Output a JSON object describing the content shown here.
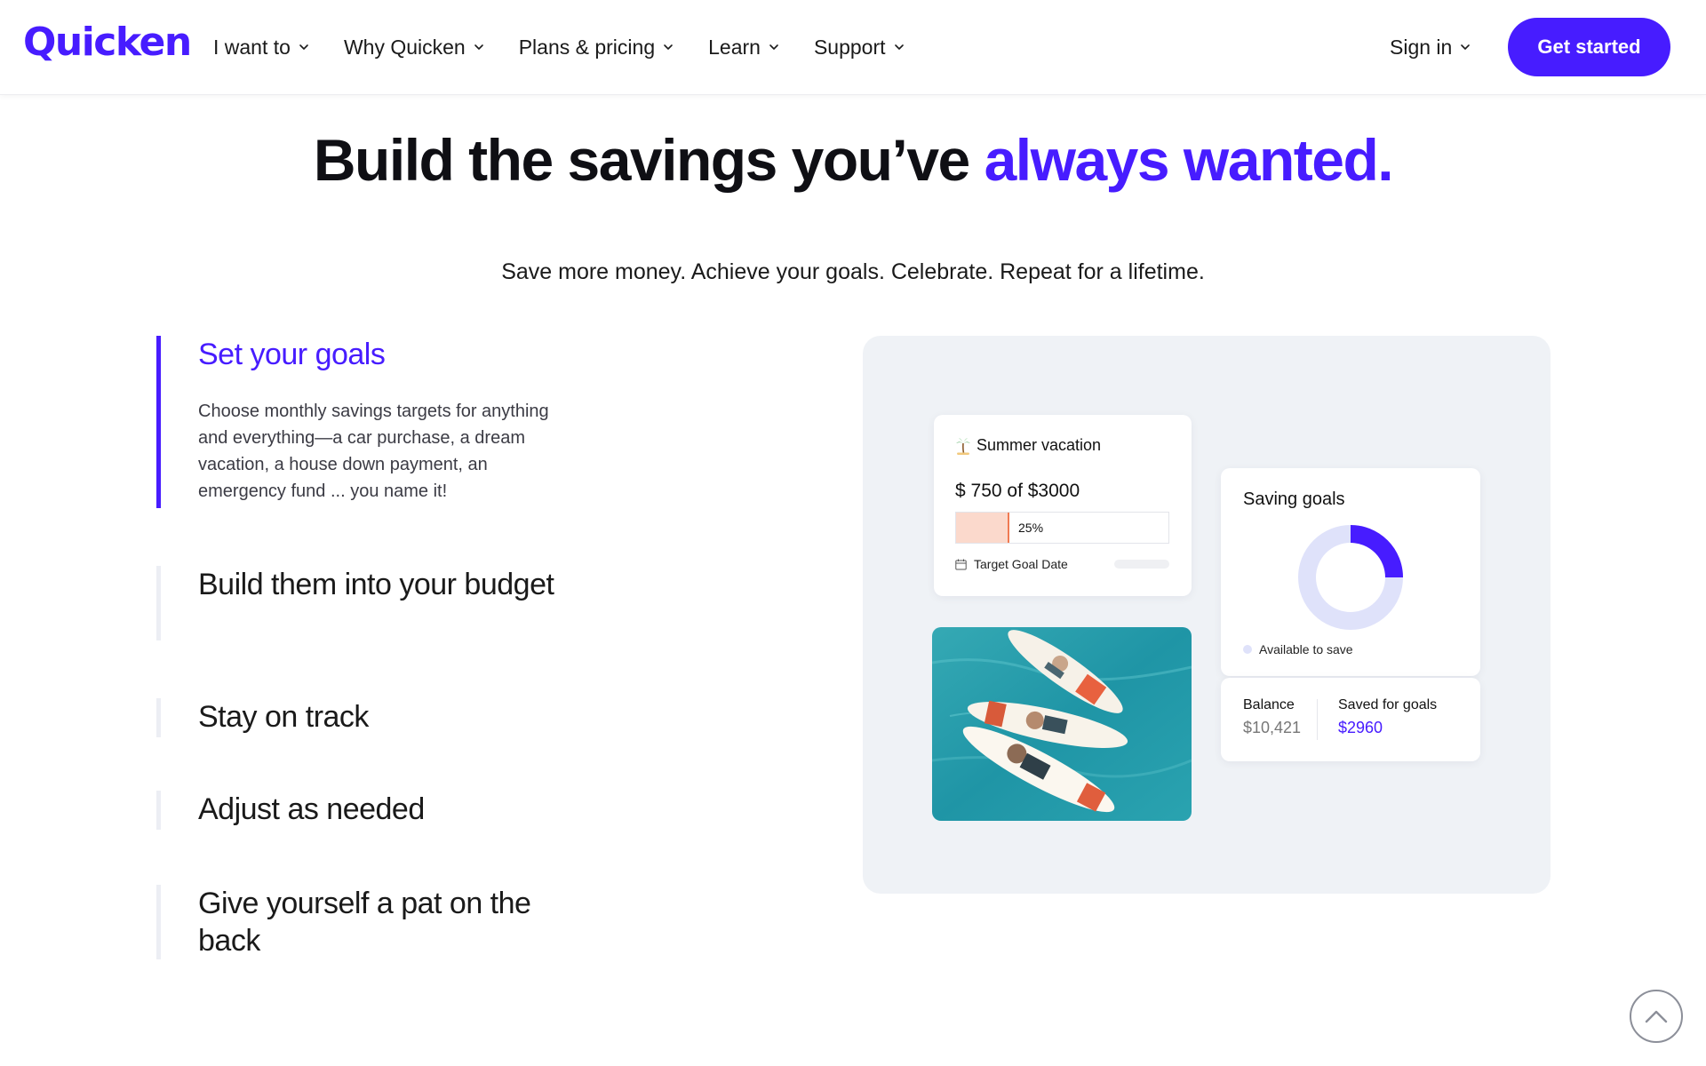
{
  "header": {
    "logo": "Quicken",
    "nav": [
      {
        "label": "I want to"
      },
      {
        "label": "Why Quicken"
      },
      {
        "label": "Plans & pricing"
      },
      {
        "label": "Learn"
      },
      {
        "label": "Support"
      }
    ],
    "sign_in": "Sign in",
    "cta": "Get started"
  },
  "hero": {
    "title_main": "Build the savings you’ve ",
    "title_accent": "always wanted.",
    "subtitle": "Save more money. Achieve your goals. Celebrate. Repeat for a lifetime."
  },
  "steps": [
    {
      "title": "Set your goals",
      "body": "Choose monthly savings targets for anything and everything—a car purchase, a dream vacation, a house down payment, an emergency fund ... you name it!",
      "active": true
    },
    {
      "title": "Build them into your budget"
    },
    {
      "title": "Stay on track"
    },
    {
      "title": "Adjust as needed"
    },
    {
      "title": "Give yourself a pat on the back"
    }
  ],
  "illustration": {
    "vacation_card": {
      "title": "Summer vacation",
      "amount": "$ 750 of  $3000",
      "progress_fraction": 0.25,
      "progress_label": "25%",
      "date_label": "Target Goal Date",
      "icons": [
        "palm-tree-icon",
        "calendar-icon"
      ]
    },
    "goals_card": {
      "title": "Saving goals",
      "donut_fraction": 0.25,
      "legend": "Available to save",
      "balance_label": "Balance",
      "balance_value": "$10,421",
      "saved_label": "Saved for goals",
      "saved_value": "$2960"
    },
    "photo": "surfboards-photo"
  },
  "colors": {
    "brand": "#471cff",
    "panel_bg": "#eff2f6",
    "progress_fill": "#fbd9cc",
    "progress_marker": "#f07a52",
    "donut_track": "#dfe2fa"
  },
  "icons": {
    "nav_dropdown": "chevron-down-icon",
    "scroll_top": "chevron-up-icon"
  }
}
